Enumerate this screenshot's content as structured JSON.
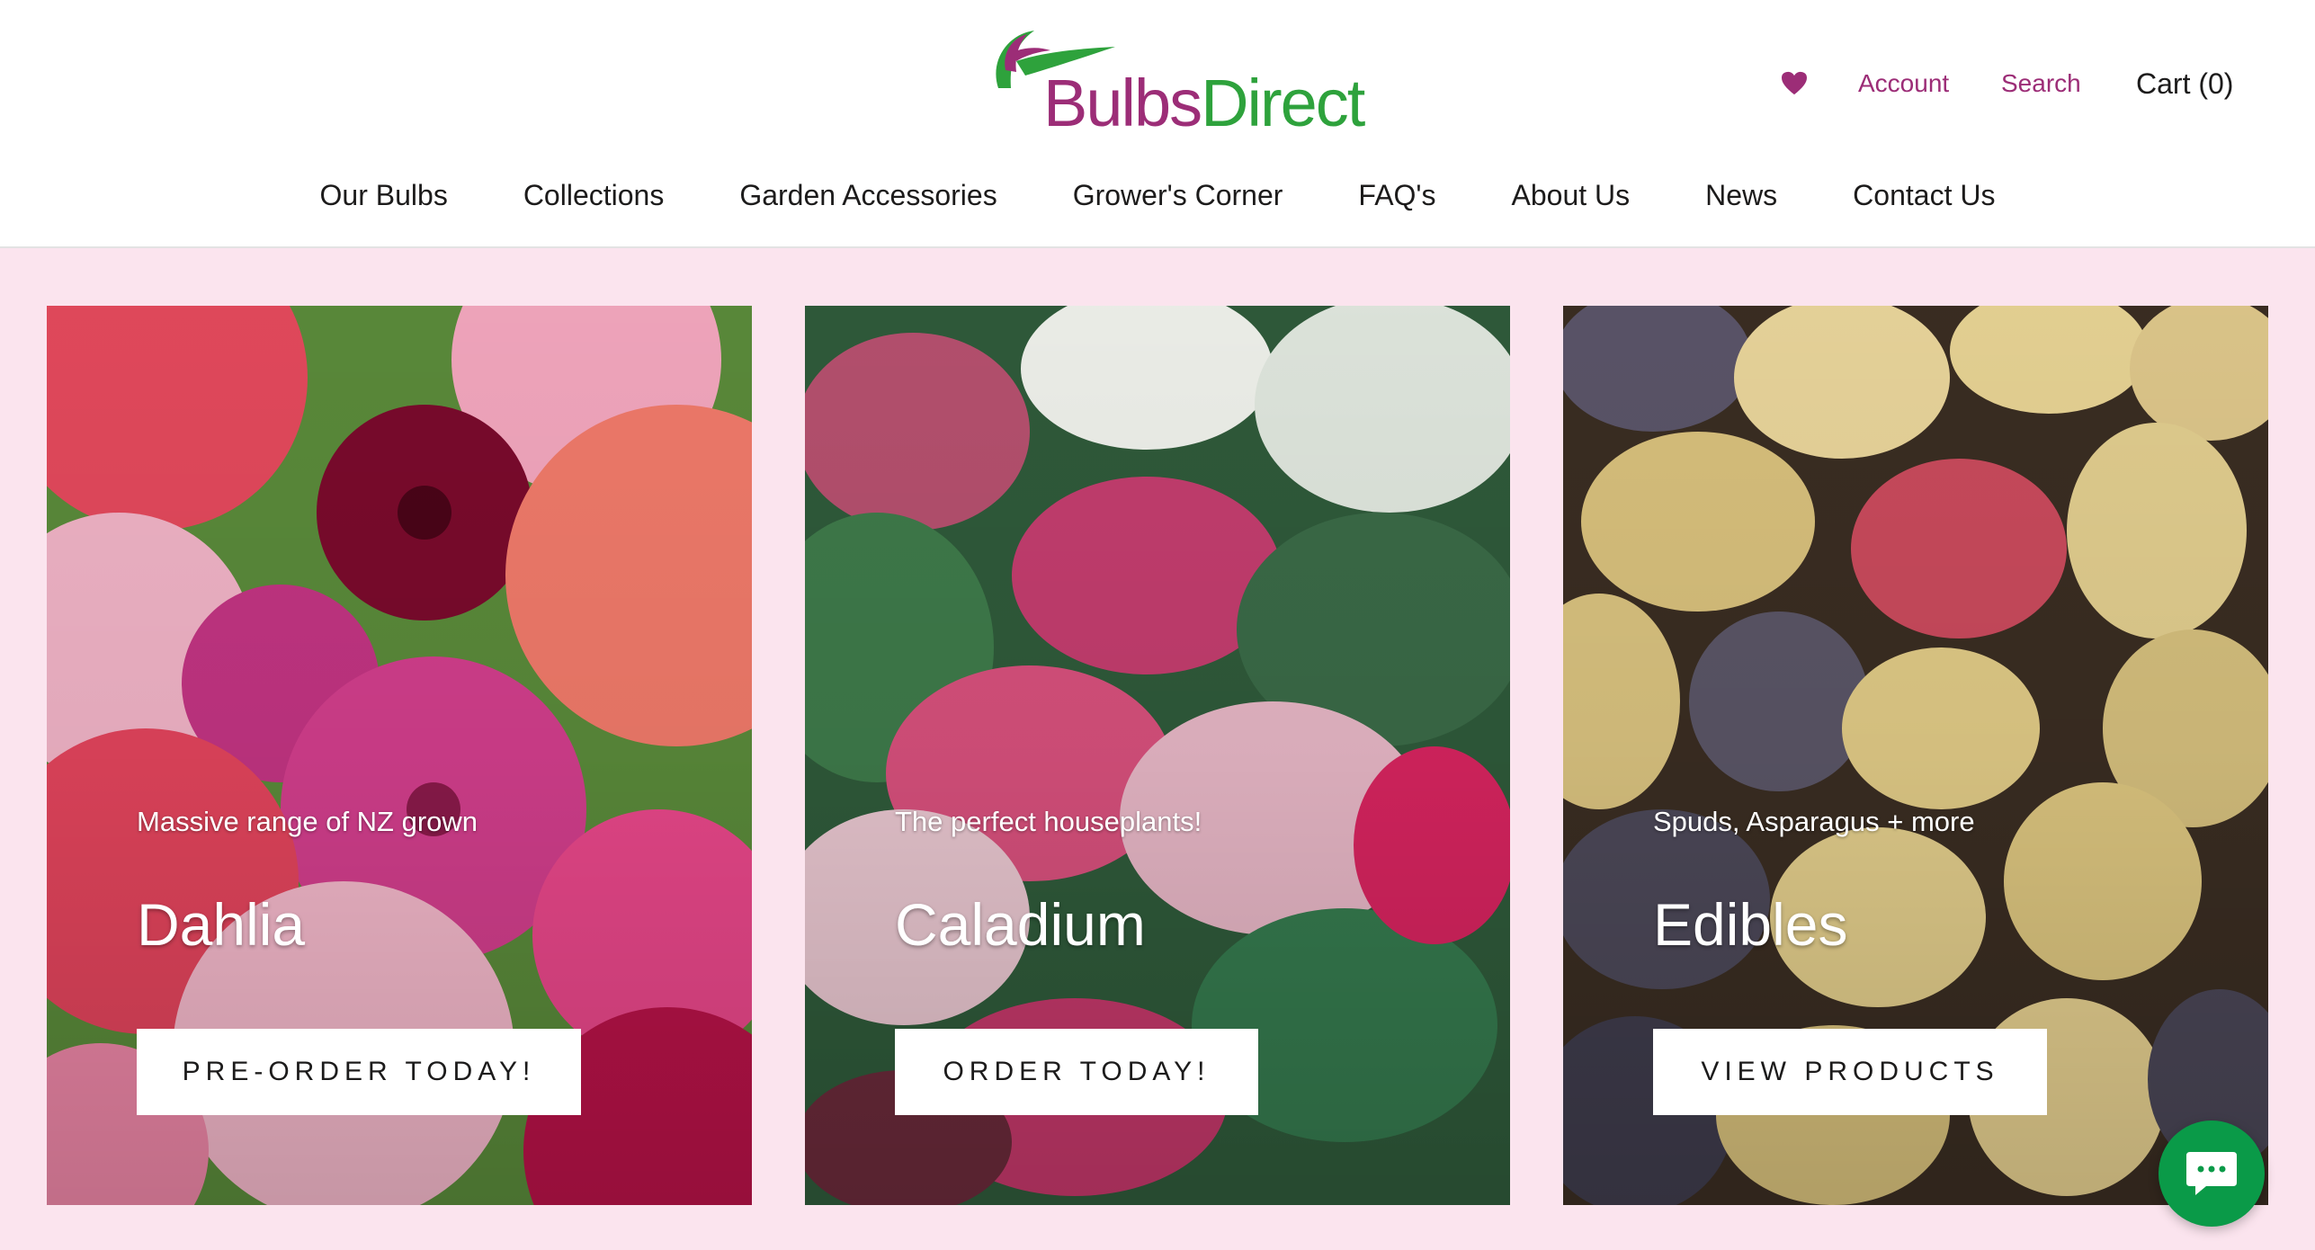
{
  "brand": {
    "logo_part1": "Bulbs",
    "logo_part2": "Direct",
    "purple": "#9c2d77",
    "green": "#2ea23c"
  },
  "utility": {
    "wishlist_icon": "heart-icon",
    "account": "Account",
    "search": "Search",
    "cart": "Cart (0)"
  },
  "nav": {
    "items": [
      {
        "label": "Our Bulbs"
      },
      {
        "label": "Collections"
      },
      {
        "label": "Garden Accessories"
      },
      {
        "label": "Grower's Corner"
      },
      {
        "label": "FAQ's"
      },
      {
        "label": "About Us"
      },
      {
        "label": "News"
      },
      {
        "label": "Contact Us"
      }
    ]
  },
  "cards": [
    {
      "subtitle": "Massive range of NZ grown",
      "title": "Dahlia",
      "button": "PRE-ORDER TODAY!"
    },
    {
      "subtitle": "The perfect houseplants!",
      "title": "Caladium",
      "button": "ORDER TODAY!"
    },
    {
      "subtitle": "Spuds, Asparagus + more",
      "title": "Edibles",
      "button": "VIEW PRODUCTS"
    }
  ],
  "chat": {
    "icon": "chat-icon",
    "color": "#0a9a48"
  }
}
